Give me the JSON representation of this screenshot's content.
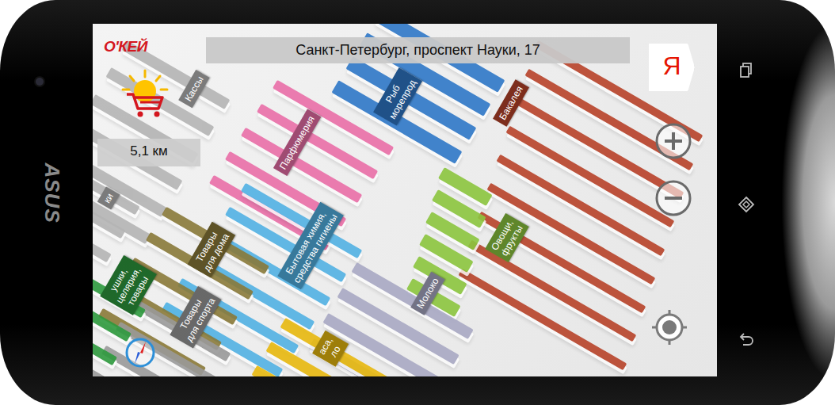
{
  "device": {
    "brand": "ASUS"
  },
  "header": {
    "logo": "О'КЕЙ",
    "address": "Санкт-Петербург, проспект Науки, 17",
    "distance": "5,1 км",
    "map_provider": "Я"
  },
  "sections": [
    {
      "lines": [
        "Кассы"
      ],
      "color": "#b5b5b5"
    },
    {
      "lines": [
        "Рыб",
        "морепрод"
      ],
      "color": "#2f78c8"
    },
    {
      "lines": [
        "Парфюмерия"
      ],
      "color": "#ea6fa8"
    },
    {
      "lines": [
        "Бакалея"
      ],
      "color": "#b8432a"
    },
    {
      "lines": [
        "Бытовая химия,",
        "средства гигиены"
      ],
      "color": "#52b2e4"
    },
    {
      "lines": [
        "Товары",
        "для дома"
      ],
      "color": "#8a7a3a"
    },
    {
      "lines": [
        "Овощи,",
        "фрукты"
      ],
      "color": "#8cc63f"
    },
    {
      "lines": [
        "Молоко"
      ],
      "color": "#a9a9c4"
    },
    {
      "lines": [
        "Товары",
        "для спорта"
      ],
      "color": "#9a9a9a"
    },
    {
      "lines": [
        "ушки,",
        "целярия,",
        "товары"
      ],
      "color": "#2e9a3e"
    },
    {
      "lines": [
        "аса,",
        "ло"
      ],
      "color": "#e8b90f"
    },
    {
      "lines": [
        "ки"
      ],
      "color": "#b5b5b5"
    }
  ]
}
